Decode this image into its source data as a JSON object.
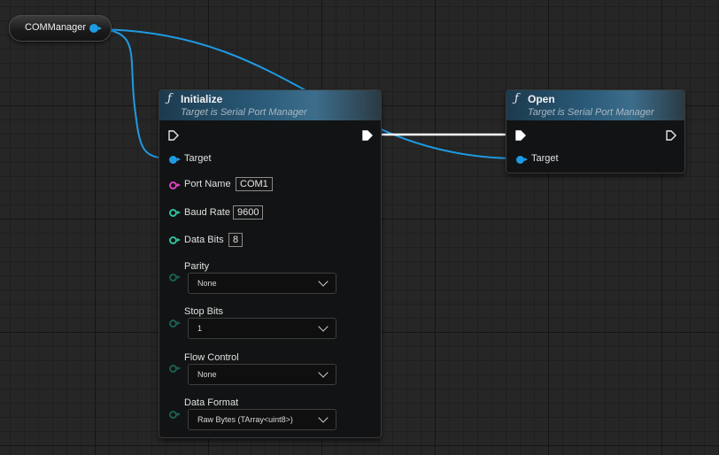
{
  "variable_node": {
    "label": "COMManager"
  },
  "initialize_node": {
    "title": "Initialize",
    "subtitle": "Target is Serial Port Manager",
    "target_label": "Target",
    "port_name": {
      "label": "Port Name",
      "value": "COM1"
    },
    "baud_rate": {
      "label": "Baud Rate",
      "value": "9600"
    },
    "data_bits": {
      "label": "Data Bits",
      "value": "8"
    },
    "parity": {
      "label": "Parity",
      "selected": "None"
    },
    "stop_bits": {
      "label": "Stop Bits",
      "selected": "1"
    },
    "flow_control": {
      "label": "Flow Control",
      "selected": "None"
    },
    "data_format": {
      "label": "Data Format",
      "selected": "Raw Bytes (TArray<uint8>)"
    }
  },
  "open_node": {
    "title": "Open",
    "subtitle": "Target is Serial Port Manager",
    "target_label": "Target"
  },
  "colors": {
    "object_pin": "#1e9be3",
    "string_pin": "#e040c0",
    "int_pin": "#2fbfa0",
    "exec_wire": "#ffffff",
    "header_accent": "#3c6e8c"
  },
  "icons": {
    "function": "function-f-icon",
    "exec": "exec-arrow-icon",
    "dropdown": "chevron-down-icon"
  }
}
